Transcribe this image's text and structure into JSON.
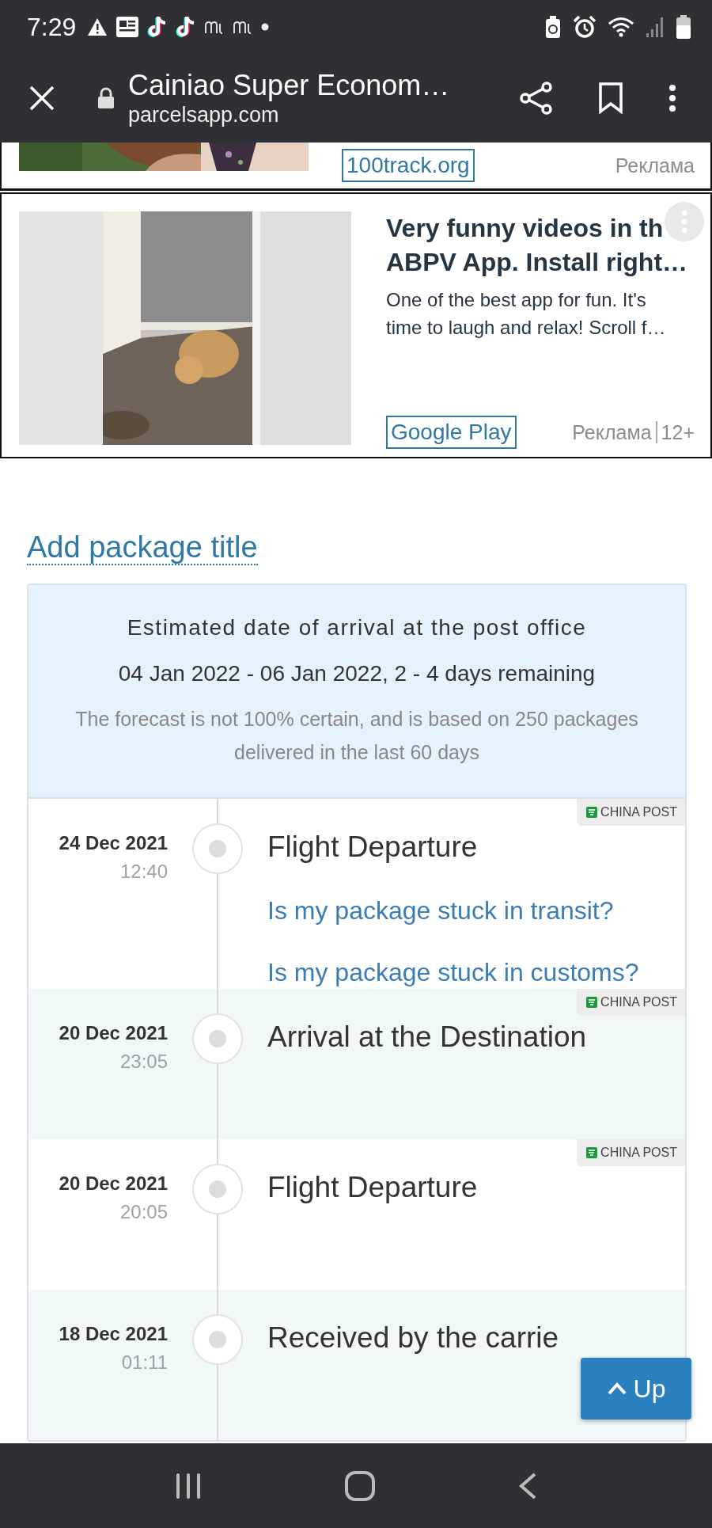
{
  "status_bar": {
    "time": "7:29"
  },
  "browser_bar": {
    "title": "Cainiao Super Econom…",
    "url": "parcelsapp.com"
  },
  "ads": [
    {
      "kind": "strip",
      "link": "100track.org",
      "label": "Реклама"
    },
    {
      "kind": "card",
      "title_lines": [
        "Very funny videos in th",
        "ABPV App. Install right…"
      ],
      "description_lines": [
        "One of the best app for fun. It's",
        "time to laugh and relax! Scroll f…"
      ],
      "link": "Google Play",
      "label": "Реклама",
      "rating": "12+"
    }
  ],
  "package_title_link": "Add package title",
  "forecast": {
    "heading": "Estimated date of arrival at the post office",
    "range": "04 Jan 2022 - 06 Jan 2022, 2 - 4 days remaining",
    "note": "The forecast is not 100% certain, and is based on 250 packages delivered in the last 60 days"
  },
  "events": [
    {
      "date": "24 Dec 2021",
      "time": "12:40",
      "title": "Flight Departure",
      "carrier": "CHINA POST",
      "links": [
        "Is my package stuck in transit?",
        "Is my package stuck in customs?"
      ]
    },
    {
      "date": "20 Dec 2021",
      "time": "23:05",
      "title": "Arrival at the Destination",
      "carrier": "CHINA POST"
    },
    {
      "date": "20 Dec 2021",
      "time": "20:05",
      "title": "Flight Departure",
      "carrier": "CHINA POST"
    },
    {
      "date": "18 Dec 2021",
      "time": "01:11",
      "title": "Received by the carrie"
    }
  ],
  "up_button": "Up"
}
